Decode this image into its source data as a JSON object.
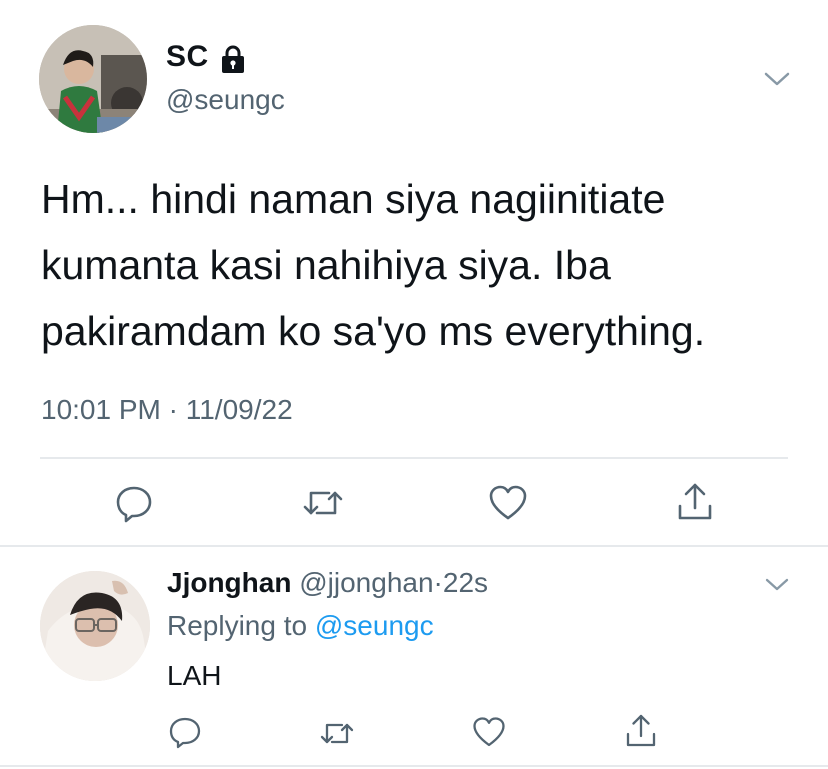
{
  "main_tweet": {
    "display_name": "SC",
    "locked": true,
    "handle": "@seungc",
    "text": "Hm... hindi naman siya nagiinitiate kumanta kasi nahihiya siya. Iba pakiramdam ko sa'yo ms everything.",
    "timestamp": "10:01 PM · 11/09/22",
    "actions": [
      "reply-icon",
      "retweet-icon",
      "like-icon",
      "share-icon"
    ]
  },
  "reply_tweet": {
    "display_name": "Jjonghan",
    "handle": "@jjonghan",
    "separator": "·",
    "time": "22s",
    "replying_prefix": "Replying to",
    "replying_mention": "@seungc",
    "text": "LAH",
    "actions": [
      "reply-icon",
      "retweet-icon",
      "like-icon",
      "share-icon"
    ]
  },
  "colors": {
    "text": "#0f1419",
    "secondary": "#536471",
    "link": "#1d9bf0",
    "divider": "#e6e9ec"
  }
}
